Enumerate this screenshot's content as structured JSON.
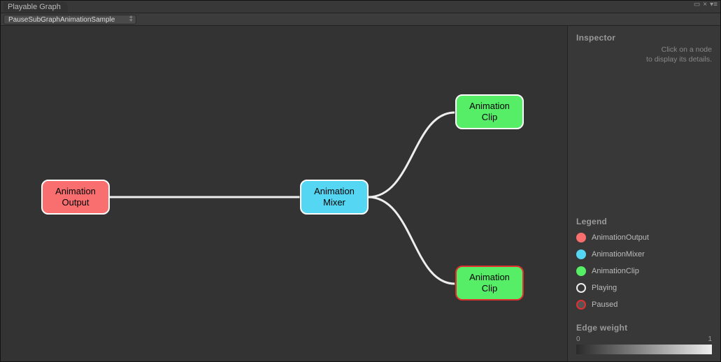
{
  "window": {
    "title": "Playable Graph"
  },
  "toolbar": {
    "dropdown": "PauseSubGraphAnimationSample"
  },
  "nodes": {
    "output": "Animation\nOutput",
    "mixer": "Animation\nMixer",
    "clip1": "Animation\nClip",
    "clip2": "Animation\nClip"
  },
  "inspector": {
    "title": "Inspector",
    "hint1": "Click on a node",
    "hint2": "to display its details."
  },
  "legend": {
    "title": "Legend",
    "items": {
      "output": "AnimationOutput",
      "mixer": "AnimationMixer",
      "clip": "AnimationClip",
      "playing": "Playing",
      "paused": "Paused"
    }
  },
  "edgeWeight": {
    "title": "Edge weight",
    "min": "0",
    "max": "1"
  }
}
